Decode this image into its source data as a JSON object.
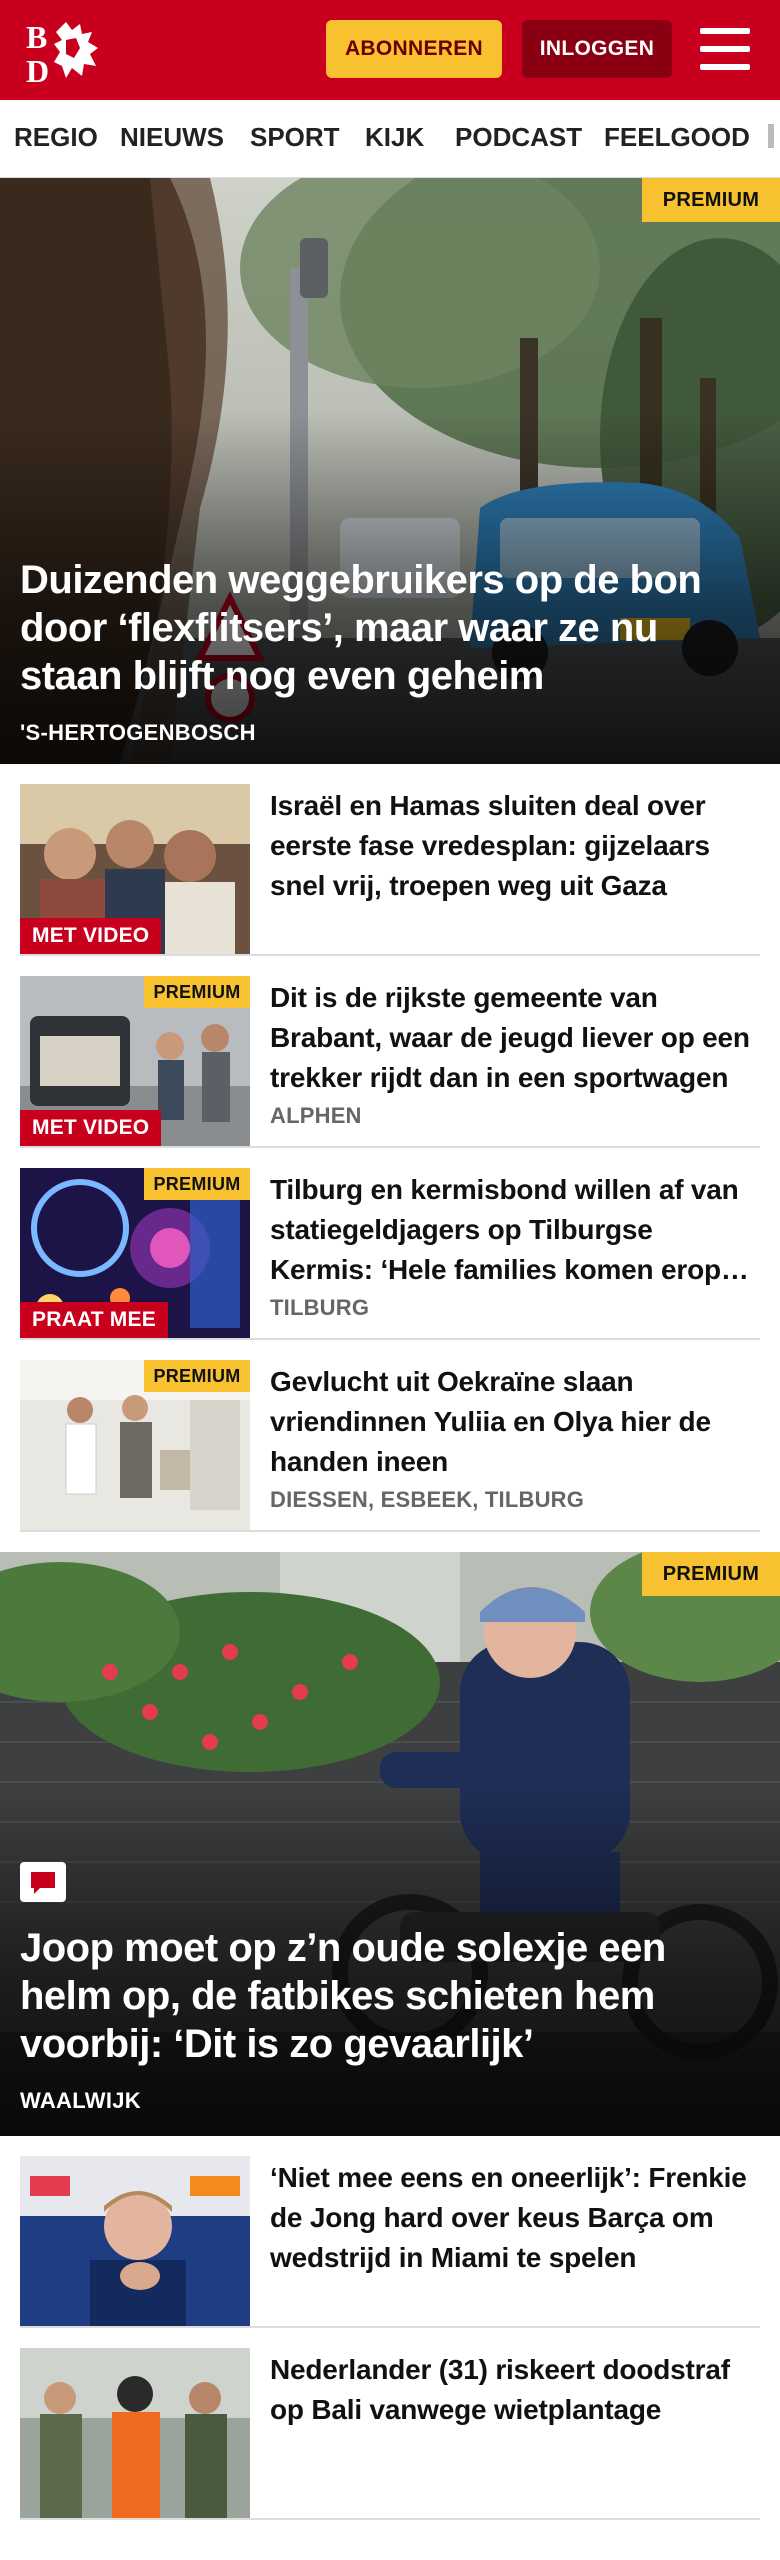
{
  "header": {
    "subscribe_label": "ABONNEREN",
    "login_label": "INLOGGEN",
    "brand_color": "#c8001e"
  },
  "nav": {
    "items": [
      "REGIO",
      "NIEUWS",
      "SPORT",
      "KIJK",
      "PODCAST",
      "FEELGOOD"
    ]
  },
  "hero1": {
    "badge": "PREMIUM",
    "headline": "Duizenden weggebruikers op de bon door ‘flexflitsers’, maar waar ze nu staan blijft nog even geheim",
    "location": "'S-HERTOGENBOSCH"
  },
  "articles1": [
    {
      "title": "Israël en Hamas sluiten deal over eerste fase vredesplan: gijzelaars snel vrij, troepen weg uit Gaza",
      "tag": "MET VIDEO"
    },
    {
      "title": "Dit is de rijkste gemeente van Brabant, waar de jeugd liever op een trekker rijdt dan in een sportwagen",
      "badge": "PREMIUM",
      "tag": "MET VIDEO",
      "location": "ALPHEN"
    },
    {
      "title": "Tilburg en kermisbond willen af van statiegeldjagers op Tilburgse Kermis: ‘Hele families komen erop af’",
      "badge": "PREMIUM",
      "tag": "PRAAT MEE",
      "location": "TILBURG"
    },
    {
      "title": "Gevlucht uit Oekraïne slaan vriendinnen Yuliia en Olya hier de handen ineen",
      "badge": "PREMIUM",
      "location": "DIESSEN, ESBEEK, TILBURG"
    }
  ],
  "hero2": {
    "badge": "PREMIUM",
    "headline": "Joop moet op z’n oude solexje een helm op, de fatbikes schieten hem voorbij: ‘Dit is zo gevaarlijk’",
    "location": "WAALWIJK"
  },
  "articles2": [
    {
      "title": "‘Niet mee eens en oneerlijk’: Frenkie de Jong hard over keus Barça om wedstrijd in Miami te spelen"
    },
    {
      "title": "Nederlander (31) riskeert doodstraf op Bali vanwege wietplantage"
    }
  ]
}
